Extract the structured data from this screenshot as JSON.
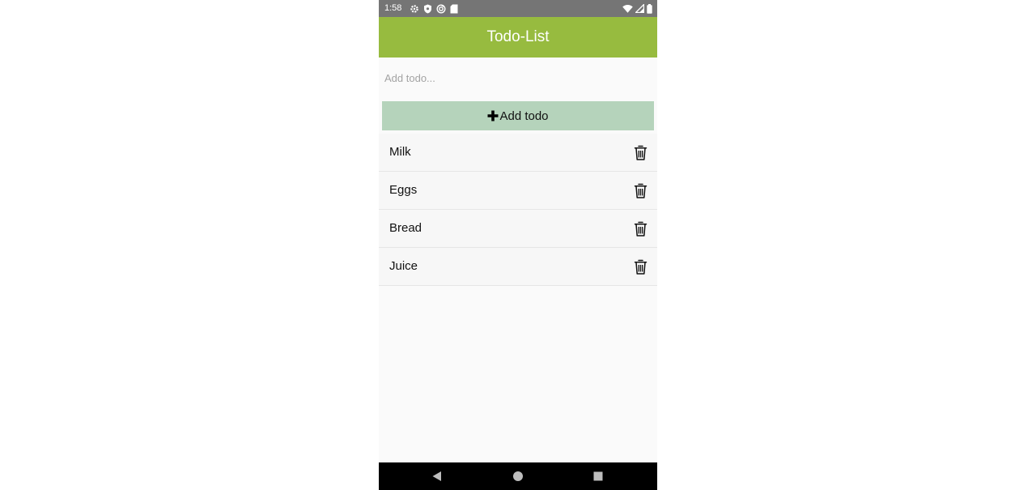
{
  "status_bar": {
    "time": "1:58",
    "left_icons": [
      "gear-icon",
      "shield-icon",
      "sync-icon",
      "sd-card-icon"
    ],
    "right_icons": [
      "wifi-icon",
      "signal-icon",
      "battery-icon"
    ]
  },
  "app_bar": {
    "title": "Todo-List",
    "color": "#97bb3f"
  },
  "input": {
    "placeholder": "Add todo...",
    "value": ""
  },
  "add_button": {
    "icon": "plus-icon",
    "label": "Add todo",
    "color": "#b5d3bb"
  },
  "todos": [
    {
      "label": "Milk",
      "action_icon": "trash-icon"
    },
    {
      "label": "Eggs",
      "action_icon": "trash-icon"
    },
    {
      "label": "Bread",
      "action_icon": "trash-icon"
    },
    {
      "label": "Juice",
      "action_icon": "trash-icon"
    }
  ],
  "nav_bar": {
    "buttons": [
      "back-icon",
      "home-icon",
      "recents-icon"
    ]
  }
}
